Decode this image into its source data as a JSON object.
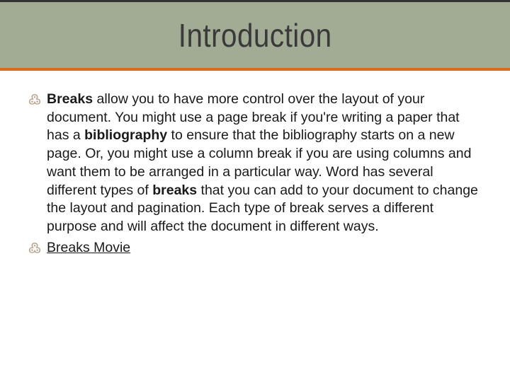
{
  "title": "Introduction",
  "bullet_glyph": "߷",
  "items": [
    {
      "segments": [
        {
          "text": "Breaks",
          "bold": true
        },
        {
          "text": " allow you to have more control over the layout of your document. You might use a page break if you're writing a paper that has a "
        },
        {
          "text": "bibliography",
          "bold": true
        },
        {
          "text": " to ensure that the bibliography starts on a new page. Or, you might use a column break if you are using columns and want them to be arranged in a particular way. Word has several different types of "
        },
        {
          "text": "breaks",
          "bold": true
        },
        {
          "text": " that you can add to your document to change the layout and pagination. Each type of break serves a different purpose and will affect the document in different ways."
        }
      ]
    },
    {
      "segments": [
        {
          "text": "Breaks Movie",
          "link": true
        }
      ]
    }
  ]
}
